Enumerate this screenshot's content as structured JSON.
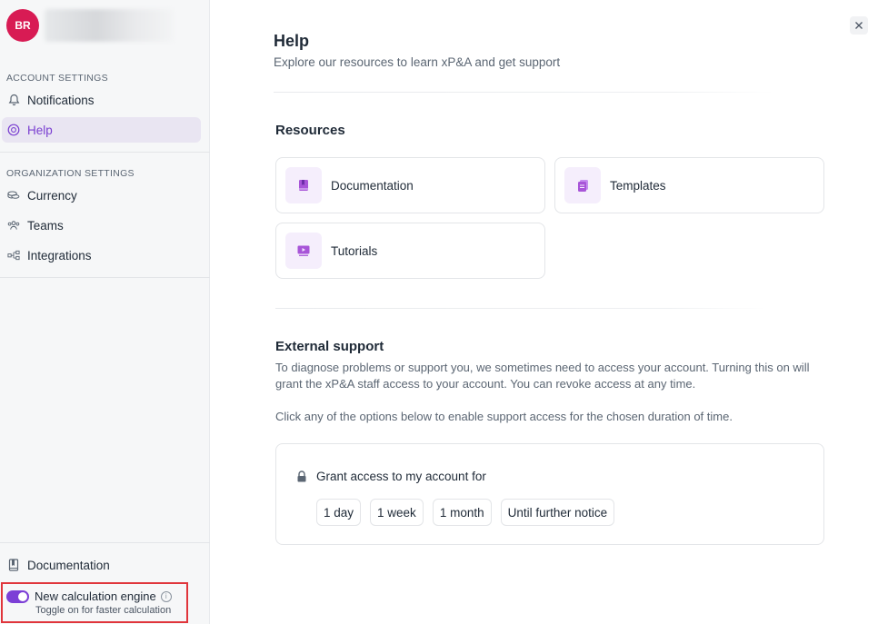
{
  "profile": {
    "initials": "BR",
    "avatar_color": "#d81b54"
  },
  "sidebar": {
    "account_section": "ACCOUNT SETTINGS",
    "account_items": [
      {
        "label": "Notifications",
        "icon": "bell-icon"
      },
      {
        "label": "Help",
        "icon": "help-circle-icon",
        "active": true
      }
    ],
    "org_section": "ORGANIZATION SETTINGS",
    "org_items": [
      {
        "label": "Currency",
        "icon": "coins-icon"
      },
      {
        "label": "Teams",
        "icon": "team-icon"
      },
      {
        "label": "Integrations",
        "icon": "integrations-icon"
      }
    ],
    "documentation": {
      "label": "Documentation",
      "icon": "book-icon"
    },
    "engine": {
      "label": "New calculation engine",
      "sublabel": "Toggle on for faster calculation",
      "enabled": true,
      "accent": "#7c3fd6"
    }
  },
  "help": {
    "title": "Help",
    "subtitle": "Explore our resources to learn xP&A and get support",
    "resources_heading": "Resources",
    "resources": [
      {
        "label": "Documentation",
        "icon": "book-icon"
      },
      {
        "label": "Templates",
        "icon": "file-stack-icon"
      },
      {
        "label": "Tutorials",
        "icon": "video-icon"
      }
    ],
    "support_heading": "External support",
    "support_paragraph1": "To diagnose problems or support you, we sometimes need to access your account. Turning this on will grant the xP&A staff access to your account. You can revoke access at any time.",
    "support_paragraph2": "Click any of the options below to enable support access for the chosen duration of time.",
    "grant_label": "Grant access to my account for",
    "durations": [
      "1 day",
      "1 week",
      "1 month",
      "Until further notice"
    ]
  },
  "colors": {
    "accent": "#7c3fd6",
    "active_bg": "#e9e5f2",
    "highlight_border": "#e0353b"
  }
}
